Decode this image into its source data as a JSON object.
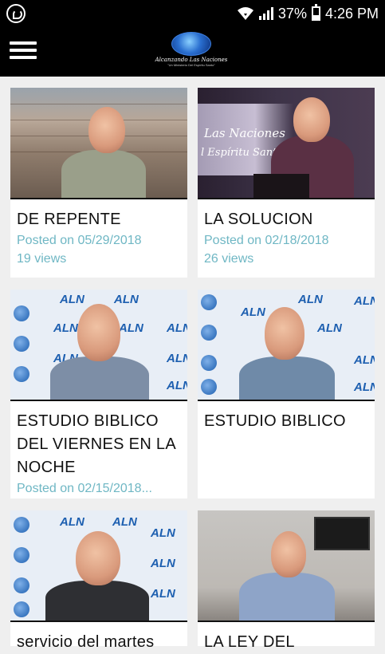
{
  "status_bar": {
    "battery": "37%",
    "time": "4:26 PM",
    "icons": [
      "whatsapp-icon",
      "wifi-icon",
      "signal-icon",
      "battery-icon"
    ]
  },
  "app_bar": {
    "menu_icon": "hamburger-menu-icon",
    "logo_text": "Alcanzando Las Naciones",
    "logo_subtext": "\"Un Ministerio Del Espíritu Santo\""
  },
  "videos": [
    {
      "title": "DE REPENTE",
      "posted": "Posted on 05/29/2018",
      "views": "19 views"
    },
    {
      "title": "LA SOLUCION",
      "posted": "Posted on 02/18/2018",
      "views": "26 views",
      "overlay_line1": "Las Naciones",
      "overlay_line2": "l Espíritu Santo\""
    },
    {
      "title": "ESTUDIO BIBLICO DEL VIERNES EN LA NOCHE",
      "posted": "Posted on 02/15/2018...",
      "views": ""
    },
    {
      "title": "ESTUDIO BIBLICO",
      "posted": "",
      "views": ""
    },
    {
      "title": "servicio del martes",
      "posted": "",
      "views": ""
    },
    {
      "title": "LA LEY DEL",
      "posted": "",
      "views": ""
    }
  ],
  "colors": {
    "background": "#efefef",
    "bars": "#000000",
    "meta_text": "#6fb7c4",
    "aln_blue": "#1d5fb0"
  },
  "aln_mark": "ALN"
}
